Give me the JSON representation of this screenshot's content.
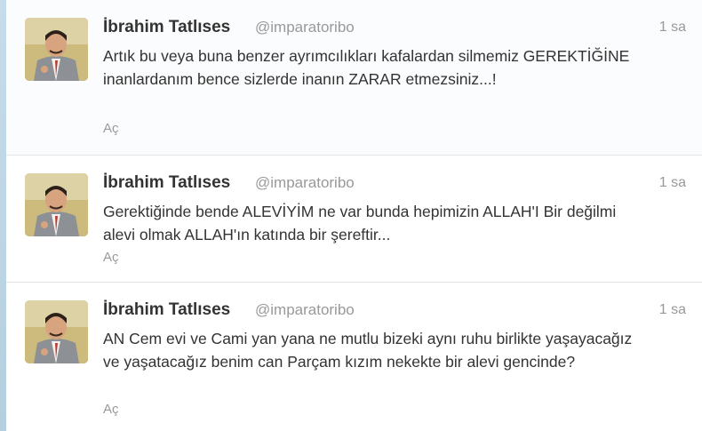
{
  "tweets": [
    {
      "fullname": "İbrahim Tatlıses",
      "username": "@imparatoribo",
      "timestamp": "1 sa",
      "text": "Artık bu veya buna benzer ayrımcılıkları kafalardan silmemiz GEREKTİĞİNE inanlardanım bence sizlerde inanın ZARAR etmezsiniz...!",
      "expand": "Aç"
    },
    {
      "fullname": "İbrahim Tatlıses",
      "username": "@imparatoribo",
      "timestamp": "1 sa",
      "text": "Gerektiğinde bende ALEVİYİM ne var bunda hepimizin ALLAH'I Bir değilmi alevi olmak ALLAH'ın katında bir şereftir...",
      "expand": "Aç"
    },
    {
      "fullname": "İbrahim Tatlıses",
      "username": "@imparatoribo",
      "timestamp": "1 sa",
      "text": "AN Cem evi ve Cami yan yana ne mutlu bizeki aynı ruhu birlikte yaşayacağız ve yaşatacağız benim can Parçam kızım nekekte bir alevi gencinde?",
      "expand": "Aç"
    }
  ]
}
